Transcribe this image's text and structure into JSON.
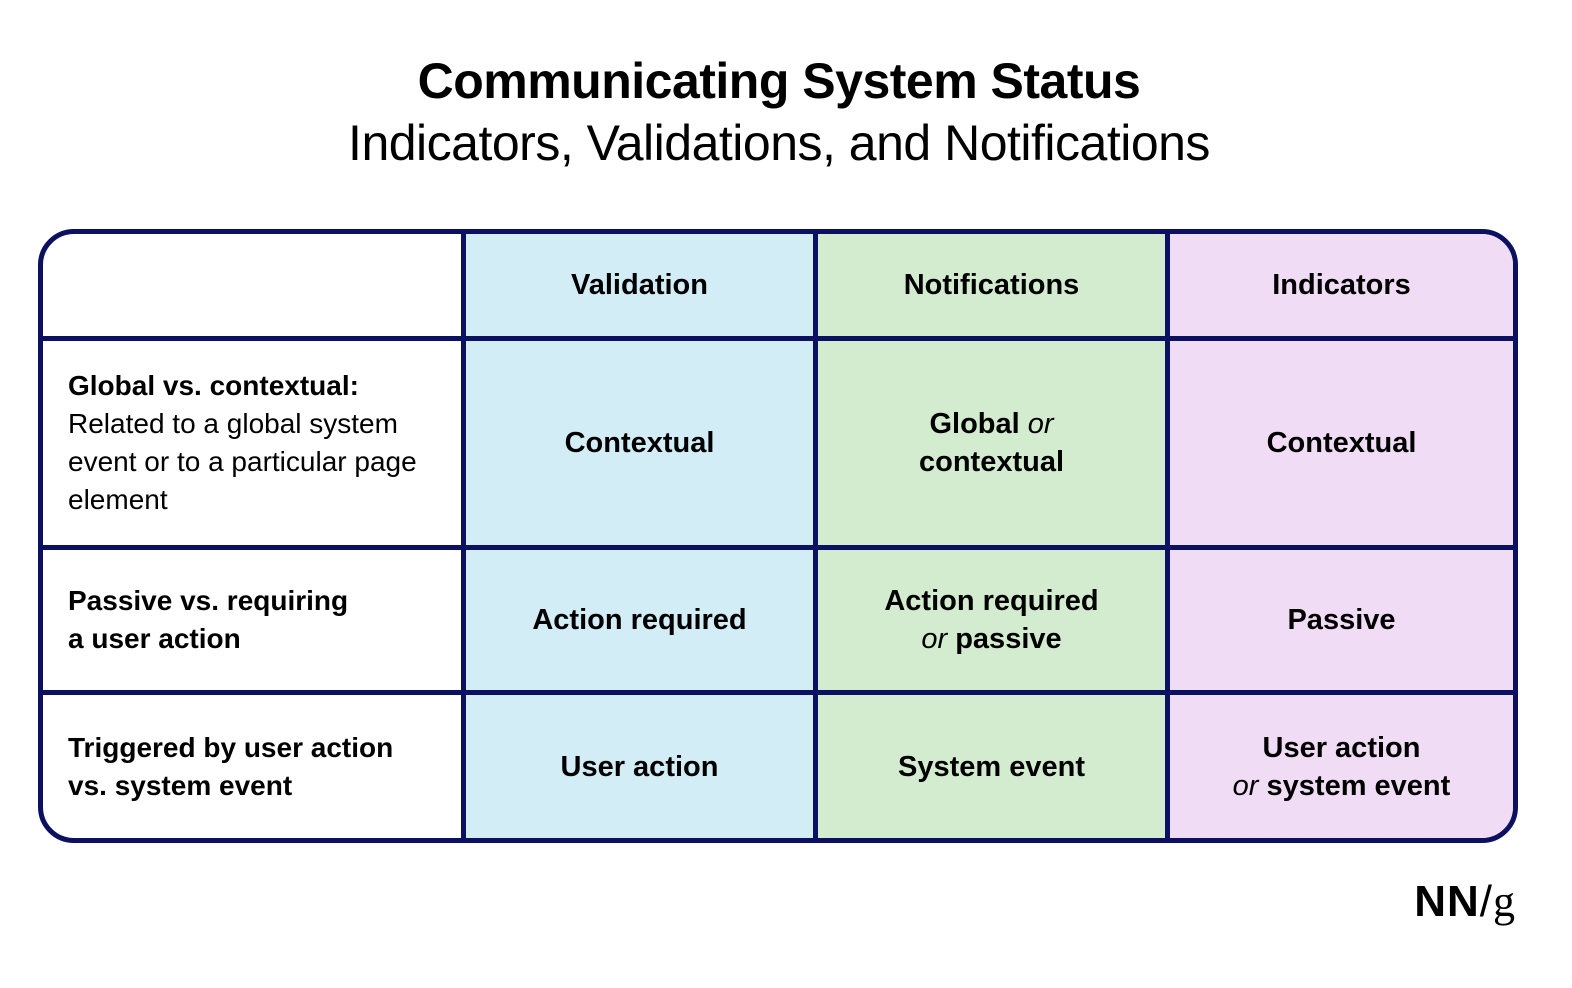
{
  "header": {
    "title": "Communicating System Status",
    "subtitle": "Indicators, Validations, and Notifications"
  },
  "colors": {
    "border": "#0b1060",
    "validation": "#d2edf6",
    "notifications": "#d3ecd0",
    "indicators": "#f0dcf4"
  },
  "table": {
    "columns": [
      "",
      "Validation",
      "Notifications",
      "Indicators"
    ],
    "rows": [
      {
        "label_bold": "Global vs. contextual:",
        "label_regular": "Related to a global system event or to a particular page element",
        "validation": "Contextual",
        "notifications": {
          "part1": "Global",
          "or": "or",
          "part2": "contextual"
        },
        "indicators": "Contextual"
      },
      {
        "label_line1": "Passive vs. requiring",
        "label_line2": "a user action",
        "validation": "Action required",
        "notifications": {
          "part1": "Action required",
          "or": "or",
          "part2": "passive"
        },
        "indicators": "Passive"
      },
      {
        "label_line1": "Triggered by user action",
        "label_line2": "vs. system event",
        "validation": "User action",
        "notifications": "System event",
        "indicators": {
          "part1": "User action",
          "or": "or",
          "part2": "system event"
        }
      }
    ]
  },
  "logo": {
    "nn": "NN",
    "slash": "/",
    "g": "g"
  }
}
